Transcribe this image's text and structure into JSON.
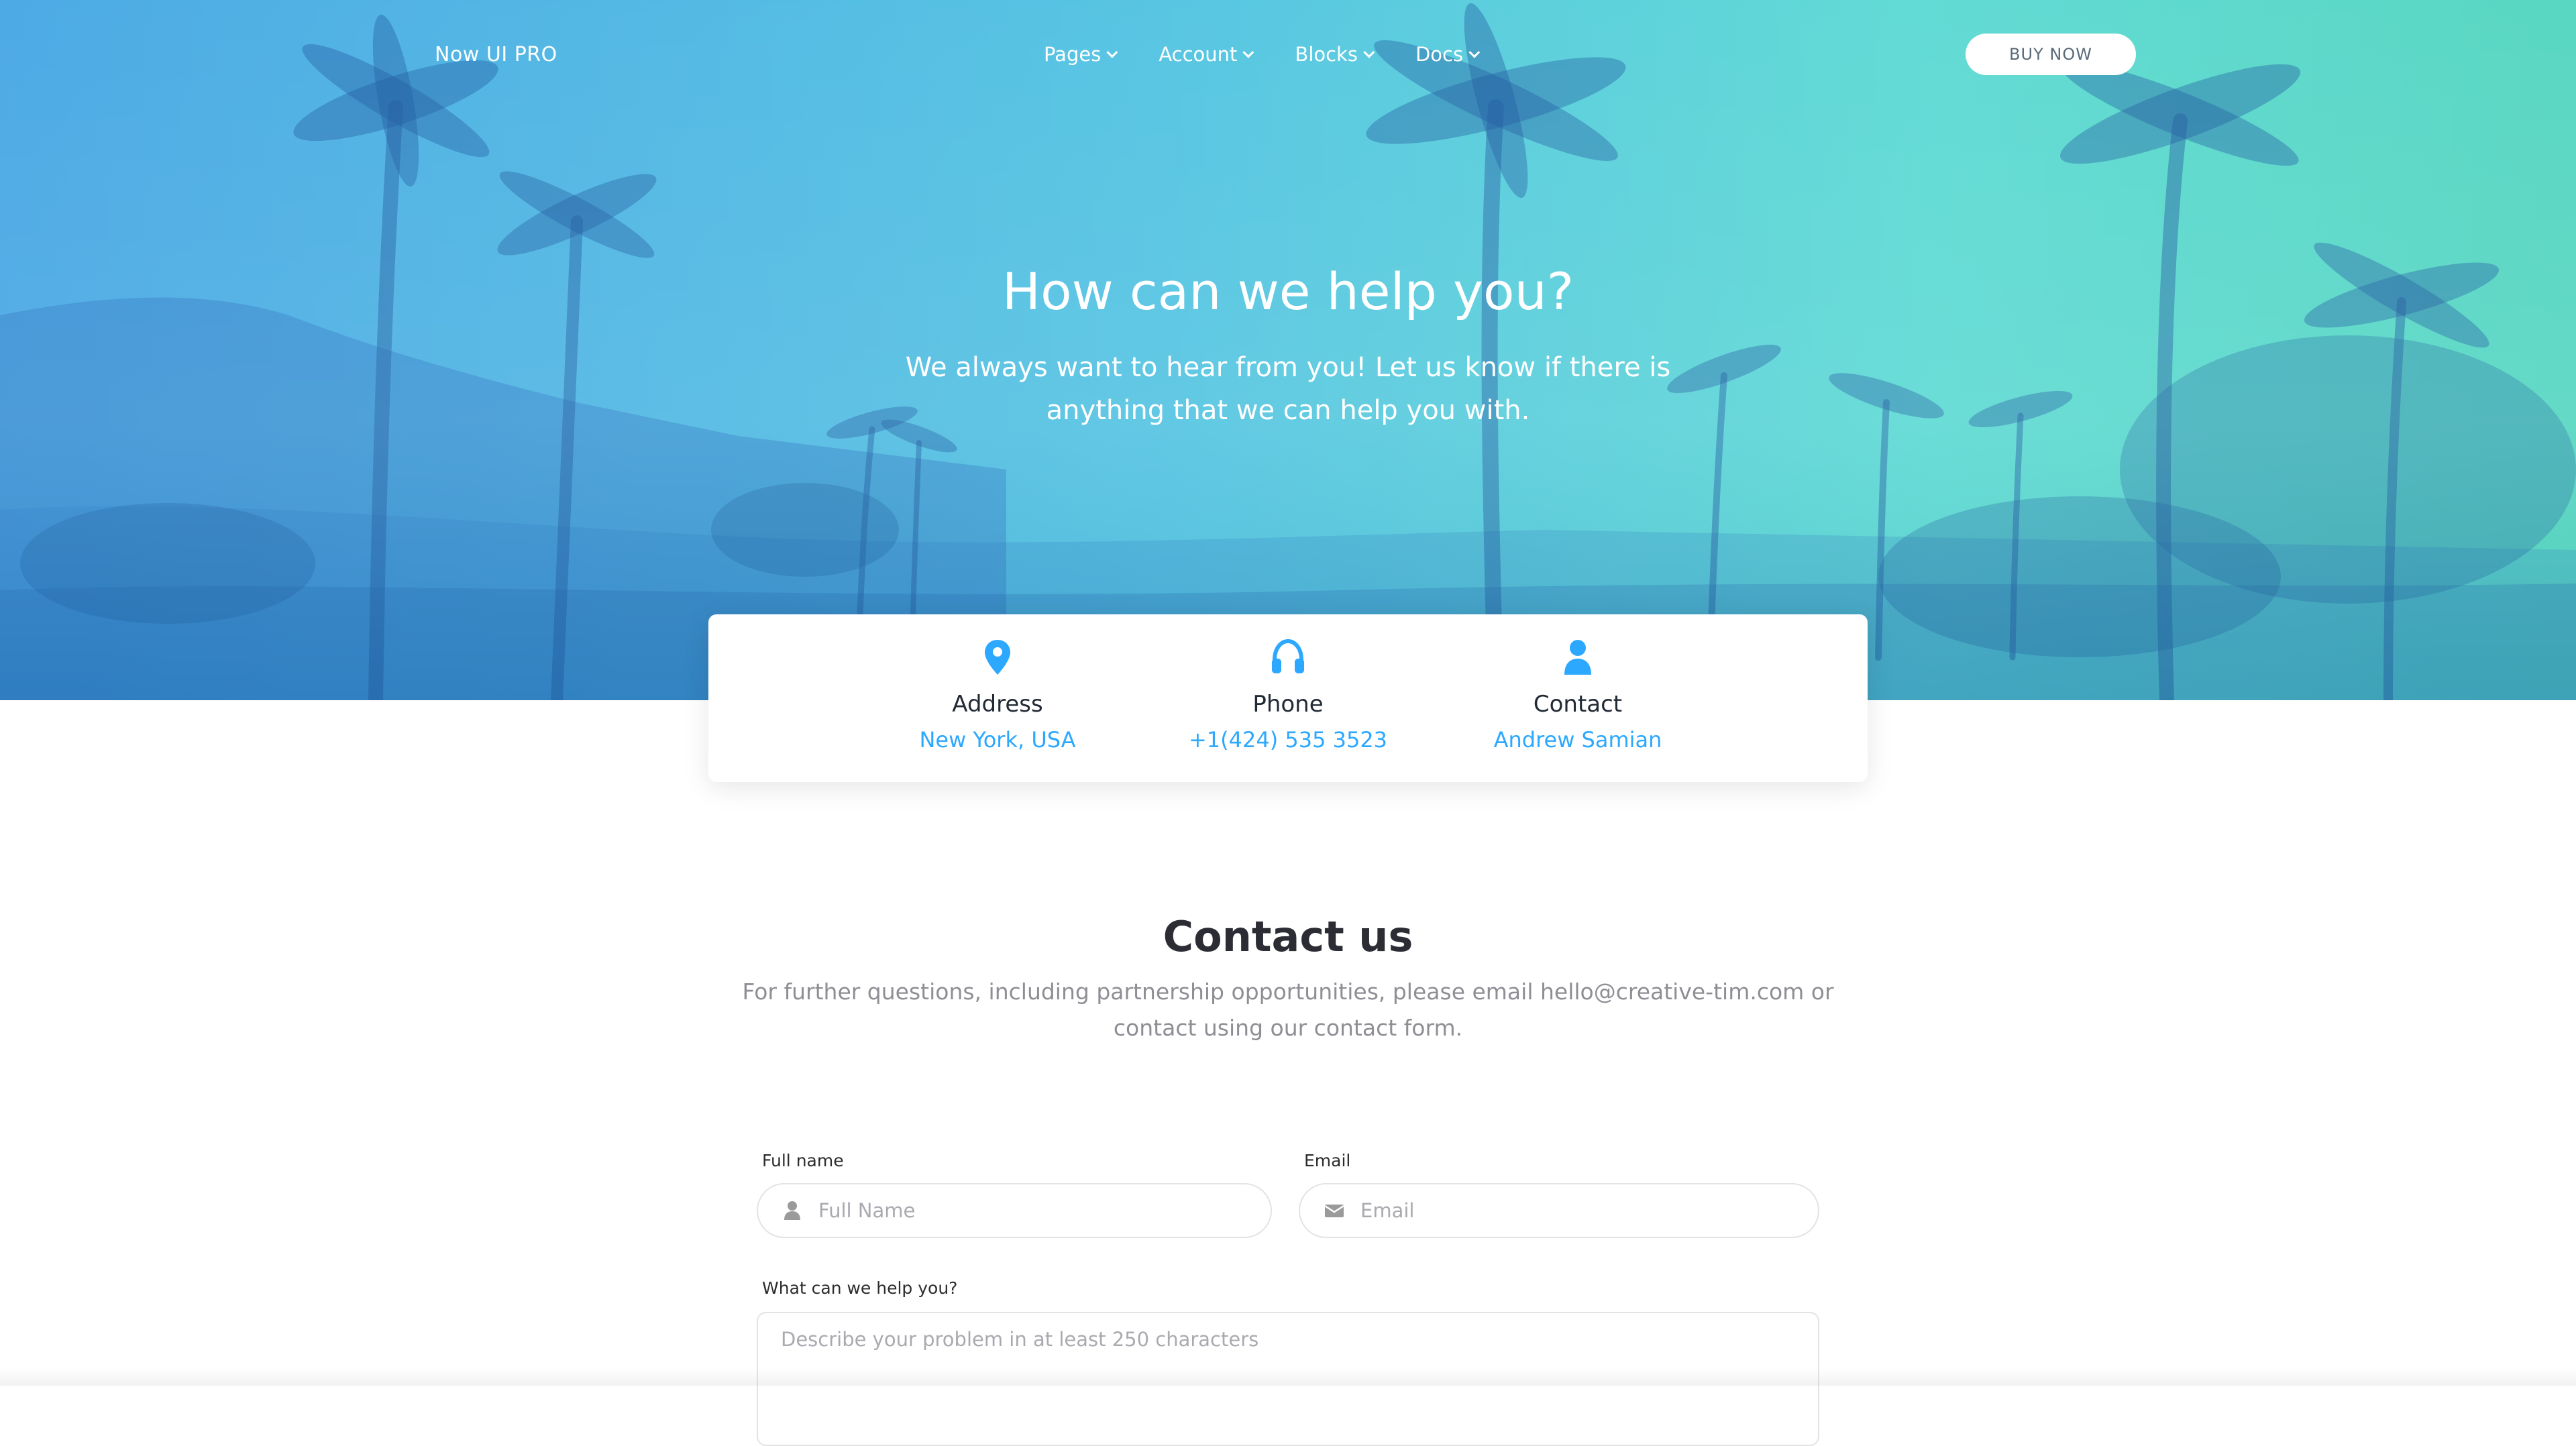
{
  "navbar": {
    "brand": "Now UI PRO",
    "items": [
      {
        "label": "Pages"
      },
      {
        "label": "Account"
      },
      {
        "label": "Blocks"
      },
      {
        "label": "Docs"
      }
    ],
    "buy_label": "BUY NOW"
  },
  "hero": {
    "title": "How can we help you?",
    "subtitle": "We always want to hear from you! Let us know if there is anything that we can help you with."
  },
  "info": [
    {
      "icon": "map-pin-icon",
      "label": "Address",
      "value": "New York, USA"
    },
    {
      "icon": "headphones-icon",
      "label": "Phone",
      "value": "+1(424) 535 3523"
    },
    {
      "icon": "user-icon",
      "label": "Contact",
      "value": "Andrew Samian"
    }
  ],
  "contact": {
    "title": "Contact us",
    "description": "For further questions, including partnership opportunities, please email hello@creative-tim.com or contact using our contact form."
  },
  "form": {
    "full_name_label": "Full name",
    "full_name_placeholder": "Full Name",
    "email_label": "Email",
    "email_placeholder": "Email",
    "message_label": "What can we help you?",
    "message_placeholder": "Describe your problem in at least 250 characters"
  },
  "colors": {
    "accent": "#2ca8ff",
    "hero_left": "#4aa8e4",
    "hero_right": "#56d6c1"
  }
}
